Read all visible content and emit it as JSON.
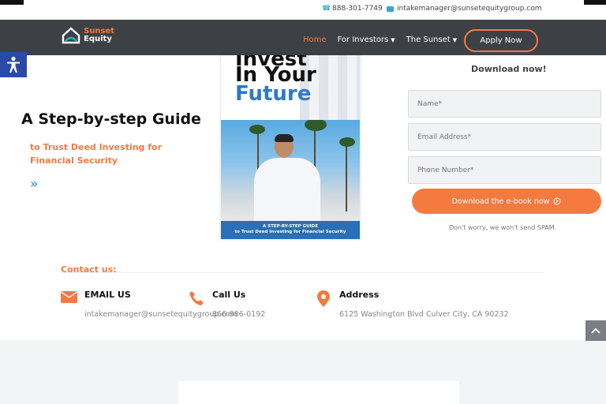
{
  "topbar": {
    "phone": "888-301-7749",
    "email": "intakemanager@sunsetequitygroup.com",
    "phone_icon": "phone-icon",
    "email_icon": "envelope-icon"
  },
  "header": {
    "logo_line1": "Sunset",
    "logo_line2": "Equity",
    "nav": {
      "home": "Home",
      "investors": "For Investors",
      "sunset": "The Sunset"
    },
    "apply_label": "Apply Now"
  },
  "hero": {
    "title": "A Step-by-step Guide",
    "subtitle": "to Trust Deed Investing for Financial Security",
    "chevrons": "»"
  },
  "book": {
    "title_line1": "Invest",
    "title_line2": "In Your",
    "title_line3": "Future",
    "footer_line1": "A STEP-BY-STEP GUIDE",
    "footer_line2": "to Trust Deed Investing for Financial Security"
  },
  "form": {
    "title": "Download now!",
    "name_placeholder": "Name*",
    "email_placeholder": "Email Address*",
    "phone_placeholder": "Phone Number*",
    "submit_label": "Download the e-book now",
    "spam_note": "Don't worry, we won't send SPAM."
  },
  "contact": {
    "label": "Contact us:",
    "email_title": "EMAIL US",
    "email_value": "intakemanager@sunsetequitygroup.com",
    "call_title": "Call Us",
    "call_value": "866-986-0192",
    "address_title": "Address",
    "address_value": "6125 Washington Blvd Culver City, CA 90232"
  },
  "colors": {
    "accent": "#f47a3f",
    "header_bg": "#3d4146",
    "link_blue": "#3aa7c9"
  }
}
